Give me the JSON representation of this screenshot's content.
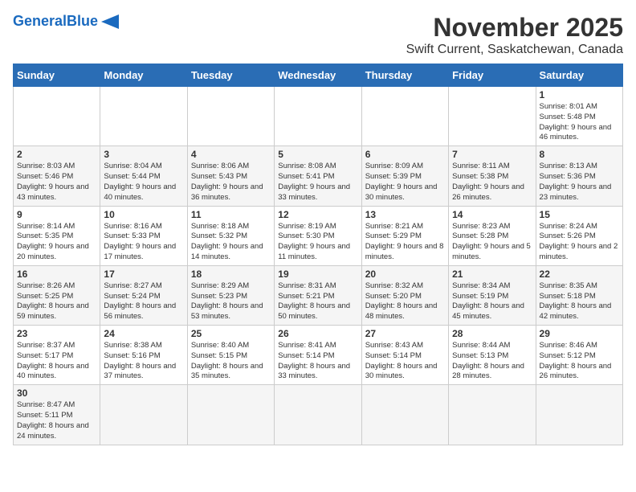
{
  "header": {
    "logo_general": "General",
    "logo_blue": "Blue",
    "month": "November 2025",
    "location": "Swift Current, Saskatchewan, Canada"
  },
  "weekdays": [
    "Sunday",
    "Monday",
    "Tuesday",
    "Wednesday",
    "Thursday",
    "Friday",
    "Saturday"
  ],
  "weeks": [
    [
      {
        "day": "",
        "info": ""
      },
      {
        "day": "",
        "info": ""
      },
      {
        "day": "",
        "info": ""
      },
      {
        "day": "",
        "info": ""
      },
      {
        "day": "",
        "info": ""
      },
      {
        "day": "",
        "info": ""
      },
      {
        "day": "1",
        "info": "Sunrise: 8:01 AM\nSunset: 5:48 PM\nDaylight: 9 hours and 46 minutes."
      }
    ],
    [
      {
        "day": "2",
        "info": "Sunrise: 8:03 AM\nSunset: 5:46 PM\nDaylight: 9 hours and 43 minutes."
      },
      {
        "day": "3",
        "info": "Sunrise: 8:04 AM\nSunset: 5:44 PM\nDaylight: 9 hours and 40 minutes."
      },
      {
        "day": "4",
        "info": "Sunrise: 8:06 AM\nSunset: 5:43 PM\nDaylight: 9 hours and 36 minutes."
      },
      {
        "day": "5",
        "info": "Sunrise: 8:08 AM\nSunset: 5:41 PM\nDaylight: 9 hours and 33 minutes."
      },
      {
        "day": "6",
        "info": "Sunrise: 8:09 AM\nSunset: 5:39 PM\nDaylight: 9 hours and 30 minutes."
      },
      {
        "day": "7",
        "info": "Sunrise: 8:11 AM\nSunset: 5:38 PM\nDaylight: 9 hours and 26 minutes."
      },
      {
        "day": "8",
        "info": "Sunrise: 8:13 AM\nSunset: 5:36 PM\nDaylight: 9 hours and 23 minutes."
      }
    ],
    [
      {
        "day": "9",
        "info": "Sunrise: 8:14 AM\nSunset: 5:35 PM\nDaylight: 9 hours and 20 minutes."
      },
      {
        "day": "10",
        "info": "Sunrise: 8:16 AM\nSunset: 5:33 PM\nDaylight: 9 hours and 17 minutes."
      },
      {
        "day": "11",
        "info": "Sunrise: 8:18 AM\nSunset: 5:32 PM\nDaylight: 9 hours and 14 minutes."
      },
      {
        "day": "12",
        "info": "Sunrise: 8:19 AM\nSunset: 5:30 PM\nDaylight: 9 hours and 11 minutes."
      },
      {
        "day": "13",
        "info": "Sunrise: 8:21 AM\nSunset: 5:29 PM\nDaylight: 9 hours and 8 minutes."
      },
      {
        "day": "14",
        "info": "Sunrise: 8:23 AM\nSunset: 5:28 PM\nDaylight: 9 hours and 5 minutes."
      },
      {
        "day": "15",
        "info": "Sunrise: 8:24 AM\nSunset: 5:26 PM\nDaylight: 9 hours and 2 minutes."
      }
    ],
    [
      {
        "day": "16",
        "info": "Sunrise: 8:26 AM\nSunset: 5:25 PM\nDaylight: 8 hours and 59 minutes."
      },
      {
        "day": "17",
        "info": "Sunrise: 8:27 AM\nSunset: 5:24 PM\nDaylight: 8 hours and 56 minutes."
      },
      {
        "day": "18",
        "info": "Sunrise: 8:29 AM\nSunset: 5:23 PM\nDaylight: 8 hours and 53 minutes."
      },
      {
        "day": "19",
        "info": "Sunrise: 8:31 AM\nSunset: 5:21 PM\nDaylight: 8 hours and 50 minutes."
      },
      {
        "day": "20",
        "info": "Sunrise: 8:32 AM\nSunset: 5:20 PM\nDaylight: 8 hours and 48 minutes."
      },
      {
        "day": "21",
        "info": "Sunrise: 8:34 AM\nSunset: 5:19 PM\nDaylight: 8 hours and 45 minutes."
      },
      {
        "day": "22",
        "info": "Sunrise: 8:35 AM\nSunset: 5:18 PM\nDaylight: 8 hours and 42 minutes."
      }
    ],
    [
      {
        "day": "23",
        "info": "Sunrise: 8:37 AM\nSunset: 5:17 PM\nDaylight: 8 hours and 40 minutes."
      },
      {
        "day": "24",
        "info": "Sunrise: 8:38 AM\nSunset: 5:16 PM\nDaylight: 8 hours and 37 minutes."
      },
      {
        "day": "25",
        "info": "Sunrise: 8:40 AM\nSunset: 5:15 PM\nDaylight: 8 hours and 35 minutes."
      },
      {
        "day": "26",
        "info": "Sunrise: 8:41 AM\nSunset: 5:14 PM\nDaylight: 8 hours and 33 minutes."
      },
      {
        "day": "27",
        "info": "Sunrise: 8:43 AM\nSunset: 5:14 PM\nDaylight: 8 hours and 30 minutes."
      },
      {
        "day": "28",
        "info": "Sunrise: 8:44 AM\nSunset: 5:13 PM\nDaylight: 8 hours and 28 minutes."
      },
      {
        "day": "29",
        "info": "Sunrise: 8:46 AM\nSunset: 5:12 PM\nDaylight: 8 hours and 26 minutes."
      }
    ],
    [
      {
        "day": "30",
        "info": "Sunrise: 8:47 AM\nSunset: 5:11 PM\nDaylight: 8 hours and 24 minutes."
      },
      {
        "day": "",
        "info": ""
      },
      {
        "day": "",
        "info": ""
      },
      {
        "day": "",
        "info": ""
      },
      {
        "day": "",
        "info": ""
      },
      {
        "day": "",
        "info": ""
      },
      {
        "day": "",
        "info": ""
      }
    ]
  ]
}
